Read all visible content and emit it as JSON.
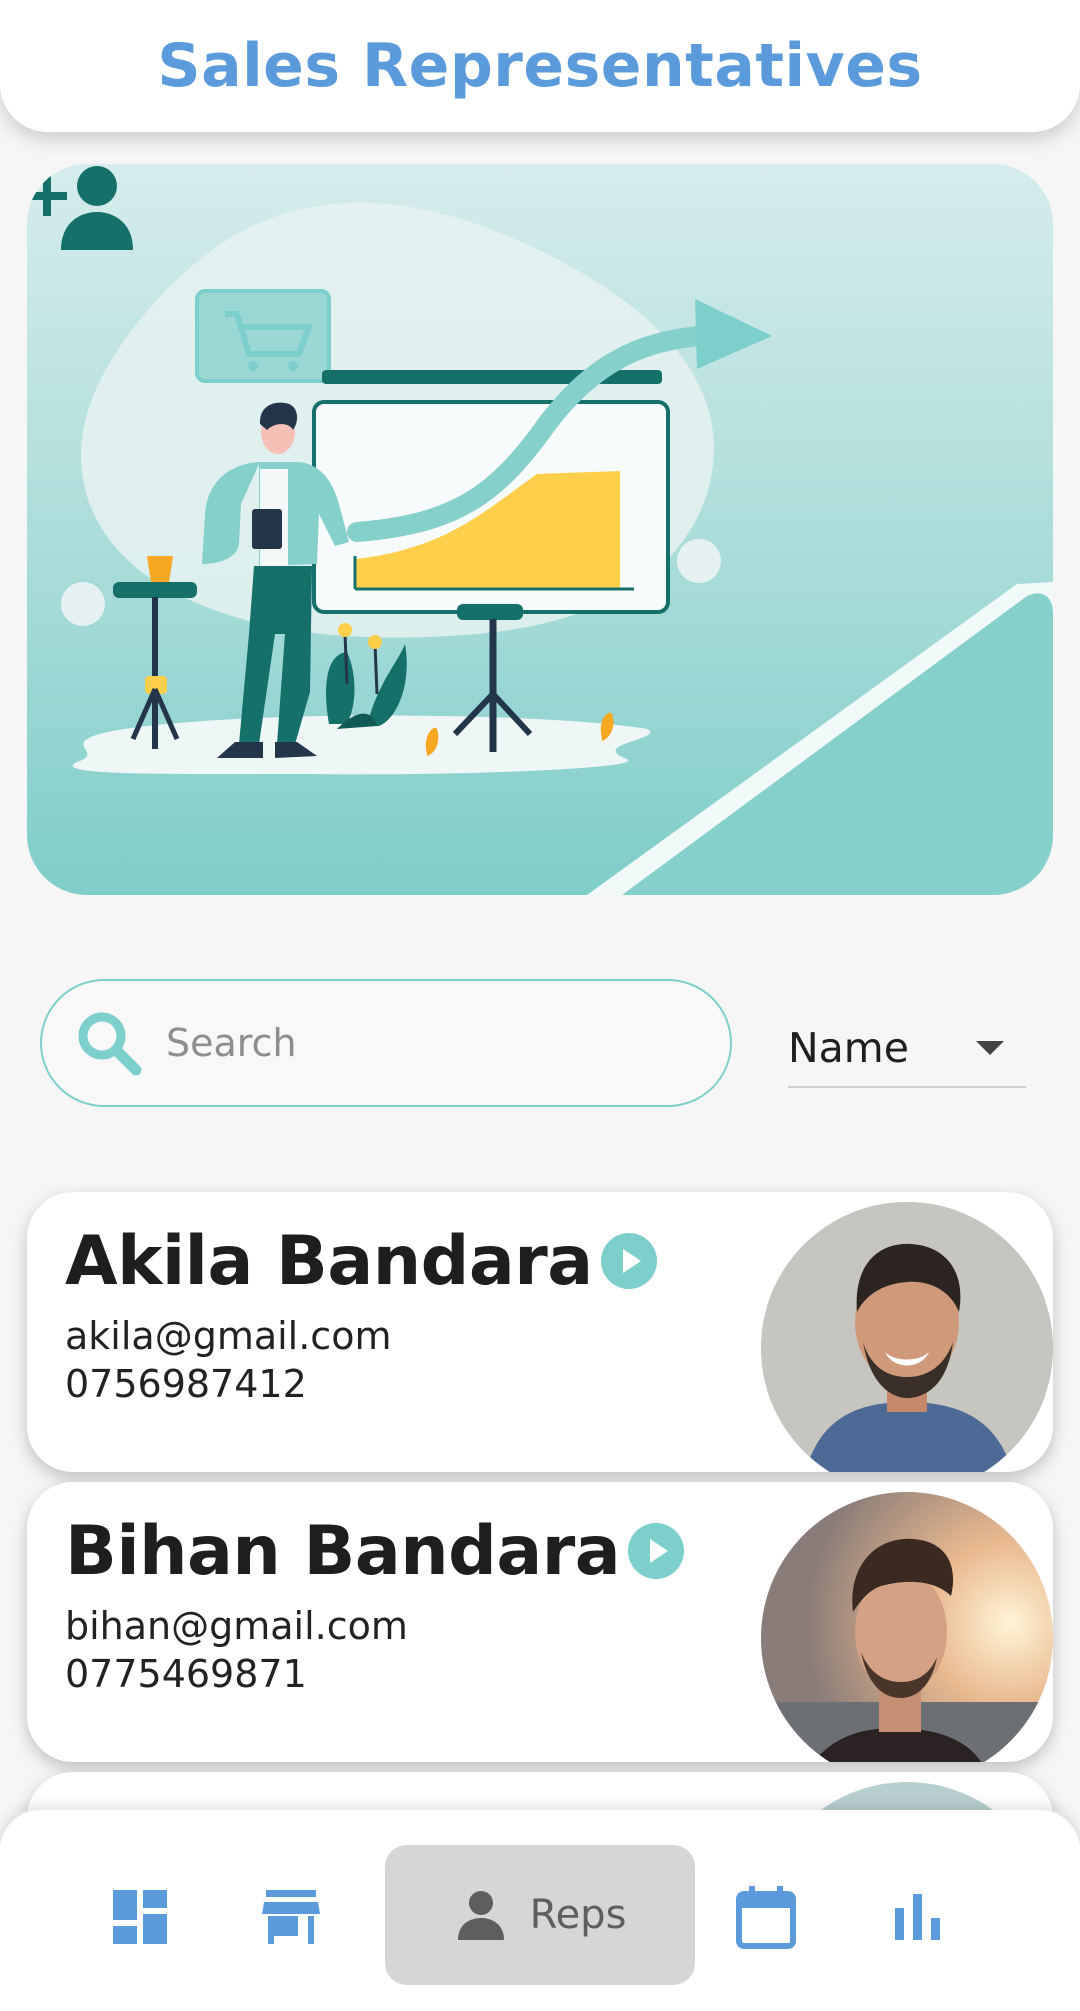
{
  "app_bar": {
    "title": "Sales Representatives"
  },
  "search": {
    "placeholder": "Search",
    "value": ""
  },
  "sort": {
    "selected": "Name"
  },
  "reps": [
    {
      "name": "Akila Bandara",
      "email": "akila@gmail.com",
      "phone": "0756987412"
    },
    {
      "name": "Bihan Bandara",
      "email": "bihan@gmail.com",
      "phone": "0775469871"
    }
  ],
  "bottom_nav": {
    "items": [
      "dashboard-icon",
      "store-icon",
      "person-icon",
      "calendar-icon",
      "bar-chart-icon"
    ],
    "active_label": "Reps"
  },
  "colors": {
    "title": "#5b9bdb",
    "teal": "#7ccfcb",
    "teal_dark": "#147068",
    "nav_blue": "#5b9bdb"
  }
}
